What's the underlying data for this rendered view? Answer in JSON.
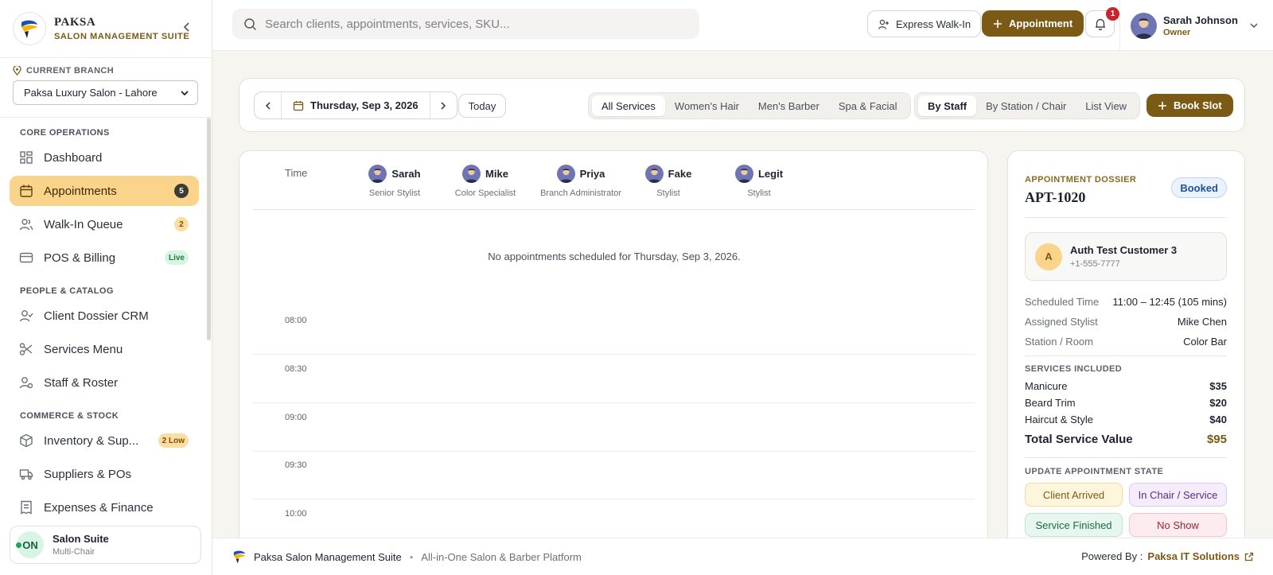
{
  "brand": {
    "name": "PAKSA",
    "subtitle": "SALON MANAGEMENT SUITE"
  },
  "branch": {
    "label": "CURRENT BRANCH",
    "selected": "Paksa Luxury Salon - Lahore"
  },
  "nav": {
    "sections": [
      {
        "title": "CORE OPERATIONS",
        "items": [
          {
            "label": "Dashboard",
            "icon": "grid-icon"
          },
          {
            "label": "Appointments",
            "icon": "calendar-icon",
            "badge": "5",
            "active": true
          },
          {
            "label": "Walk-In Queue",
            "icon": "users-icon",
            "badge": "2"
          },
          {
            "label": "POS & Billing",
            "icon": "card-icon",
            "badge": "Live"
          }
        ]
      },
      {
        "title": "PEOPLE & CATALOG",
        "items": [
          {
            "label": "Client Dossier CRM",
            "icon": "user-check-icon"
          },
          {
            "label": "Services Menu",
            "icon": "scissors-icon"
          },
          {
            "label": "Staff & Roster",
            "icon": "staff-icon"
          }
        ]
      },
      {
        "title": "COMMERCE & STOCK",
        "items": [
          {
            "label": "Inventory & Sup...",
            "icon": "box-icon",
            "badge": "2 Low"
          },
          {
            "label": "Suppliers & POs",
            "icon": "truck-icon"
          },
          {
            "label": "Expenses & Finance",
            "icon": "receipt-icon"
          }
        ]
      }
    ]
  },
  "sidebar_footer": {
    "status": "ON",
    "title": "Salon Suite",
    "subtitle": "Multi-Chair"
  },
  "topbar": {
    "search_placeholder": "Search clients, appointments, services, SKU...",
    "express_label": "Express Walk-In",
    "appointment_label": "Appointment",
    "notification_count": "1",
    "user_name": "Sarah Johnson",
    "user_role": "Owner"
  },
  "toolbar": {
    "date": "Thursday, Sep 3, 2026",
    "today_label": "Today",
    "service_filters": [
      "All Services",
      "Women's Hair",
      "Men's Barber",
      "Spa & Facial"
    ],
    "service_selected": 0,
    "views": [
      "By Staff",
      "By Station / Chair",
      "List View"
    ],
    "view_selected": 0,
    "book_label": "Book Slot"
  },
  "calendar": {
    "time_header": "Time",
    "staff": [
      {
        "name": "Sarah",
        "role": "Senior Stylist"
      },
      {
        "name": "Mike",
        "role": "Color Specialist"
      },
      {
        "name": "Priya",
        "role": "Branch Administrator"
      },
      {
        "name": "Fake",
        "role": "Stylist"
      },
      {
        "name": "Legit",
        "role": "Stylist"
      }
    ],
    "empty_message": "No appointments scheduled for Thursday, Sep 3, 2026.",
    "slots": [
      "08:00",
      "08:30",
      "09:00",
      "09:30",
      "10:00"
    ]
  },
  "dossier": {
    "label": "APPOINTMENT DOSSIER",
    "id": "APT-1020",
    "status": "Booked",
    "customer": {
      "initial": "A",
      "name": "Auth Test Customer 3",
      "phone": "+1-555-7777"
    },
    "details": [
      {
        "key": "Scheduled Time",
        "value": "11:00 – 12:45 (105 mins)"
      },
      {
        "key": "Assigned Stylist",
        "value": "Mike Chen"
      },
      {
        "key": "Station / Room",
        "value": "Color Bar"
      }
    ],
    "services_title": "SERVICES INCLUDED",
    "services": [
      {
        "name": "Manicure",
        "price": "$35"
      },
      {
        "name": "Beard Trim",
        "price": "$20"
      },
      {
        "name": "Haircut & Style",
        "price": "$40"
      }
    ],
    "total_label": "Total Service Value",
    "total_value": "$95",
    "state_title": "UPDATE APPOINTMENT STATE",
    "states": [
      "Client Arrived",
      "In Chair / Service",
      "Service Finished",
      "No Show"
    ]
  },
  "footer": {
    "name": "Paksa Salon Management Suite",
    "tagline": "All-in-One Salon & Barber Platform",
    "powered_label": "Powered By :",
    "company": "Paksa IT Solutions"
  }
}
